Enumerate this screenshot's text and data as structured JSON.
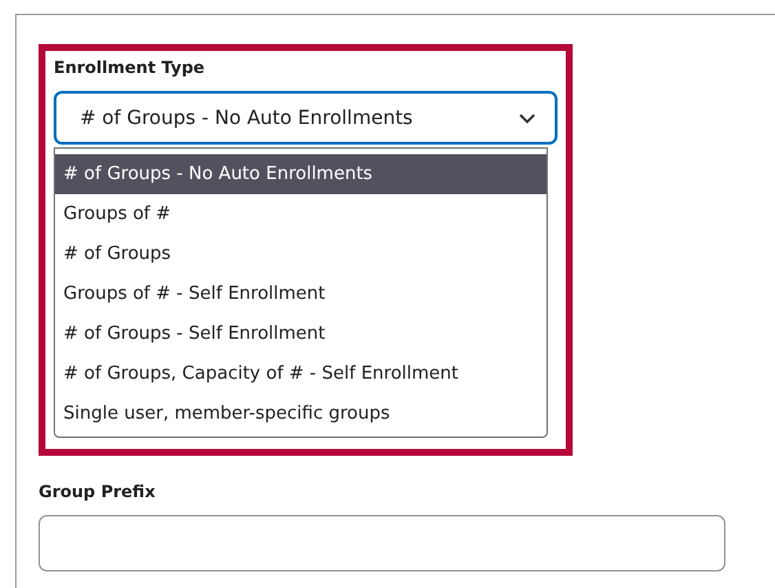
{
  "enrollment_type": {
    "label": "Enrollment Type",
    "value": "# of Groups - No Auto Enrollments",
    "options": [
      {
        "label": "# of Groups - No Auto Enrollments",
        "selected": true
      },
      {
        "label": "Groups of #",
        "selected": false
      },
      {
        "label": "# of Groups",
        "selected": false
      },
      {
        "label": "Groups of # - Self Enrollment",
        "selected": false
      },
      {
        "label": "# of Groups - Self Enrollment",
        "selected": false
      },
      {
        "label": "# of Groups, Capacity of # - Self Enrollment",
        "selected": false
      },
      {
        "label": "Single user, member-specific groups",
        "selected": false
      }
    ]
  },
  "group_prefix": {
    "label": "Group Prefix"
  }
}
